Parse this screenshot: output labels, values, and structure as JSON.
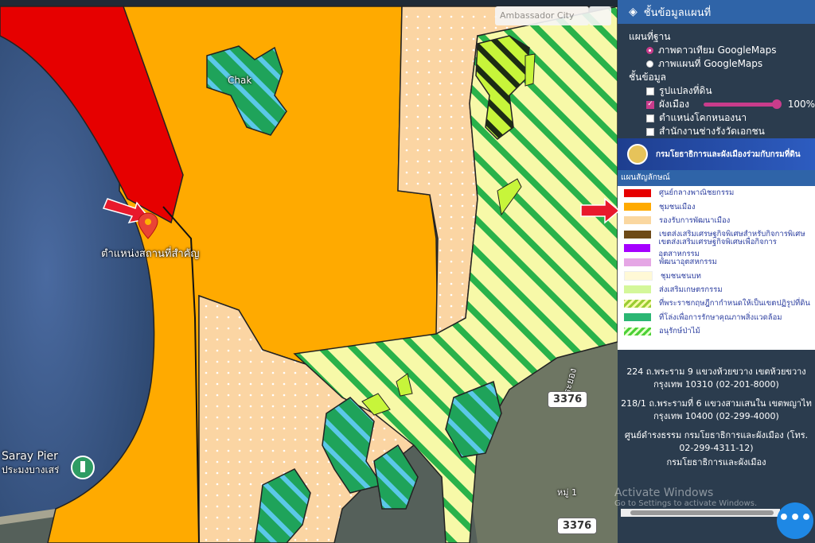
{
  "map": {
    "pin_label": "ตำแหน่งสถานที่สำคัญ",
    "search_placeholder": "Ambassador City",
    "place_labels": [
      "Saray Pier",
      "ประมงบางเสร่",
      "Chak",
      "ระยอง"
    ],
    "road_shields": [
      "3376",
      "3376"
    ],
    "village": "หมู่ 1"
  },
  "panel": {
    "title": "ชั้นข้อมูลแผนที่",
    "basemap": {
      "label": "แผนที่ฐาน",
      "options": [
        {
          "label": "ภาพดาวเทียม GoogleMaps",
          "selected": true
        },
        {
          "label": "ภาพแผนที่ GoogleMaps",
          "selected": false
        }
      ]
    },
    "data": {
      "label": "ชั้นข้อมูล",
      "layers": [
        {
          "label": "รูปแปลงที่ดิน",
          "checked": false
        },
        {
          "label": "ผังเมือง",
          "checked": true,
          "opacity": "100%"
        },
        {
          "label": "ตำแหน่งโคกหนองนา",
          "checked": false
        },
        {
          "label": "สำนักงานช่างรังวัดเอกชน",
          "checked": false
        }
      ]
    },
    "banner": "กรมโยธาธิการและผังเมืองร่วมกับกรมที่ดิน",
    "legend": {
      "title": "แผนสัญลักษณ์",
      "items": [
        {
          "label": "ศูนย์กลางพาณิชยกรรม",
          "color": "#e60000",
          "style": "solid"
        },
        {
          "label": "ชุมชนเมือง",
          "color": "#ffaa00",
          "style": "solid"
        },
        {
          "label": "รองรับการพัฒนาเมือง",
          "color": "#fad7a0",
          "style": "solid"
        },
        {
          "label": "เขตส่งเสริมเศรษฐกิจพิเศษสำหรับกิจการพิเศษ",
          "color": "#6e4a17",
          "style": "solid"
        },
        {
          "label": "เขตส่งเสริมเศรษฐกิจพิเศษเพื่อกิจการอุตสาหกรรม",
          "color": "#a500ff",
          "style": "solid"
        },
        {
          "label": "พัฒนาอุตสหกรรม",
          "color": "#e5a6e5",
          "style": "solid"
        },
        {
          "label": "ชุมชนชนบท",
          "color": "#fff9d6",
          "style": "solid"
        },
        {
          "label": "ส่งเสริมเกษตรกรรม",
          "color": "#d4f79a",
          "style": "solid"
        },
        {
          "label": "ที่พระราชกฤษฎีกากำหนดให้เป็นเขตปฏิรูปที่ดิน",
          "color": "#9acd32",
          "style": "hatch-yellow"
        },
        {
          "label": "ที่โล่งเพื่อการรักษาคุณภาพสิ่งแวดล้อม",
          "color": "#2bb673",
          "style": "solid-green"
        },
        {
          "label": "อนุรักษ์ป่าไม้",
          "color": "#4cd137",
          "style": "hatch-green"
        }
      ]
    },
    "footer": [
      "224 ถ.พระราม 9 แขวงห้วยขวาง เขตห้วยขวาง กรุงเทพ 10310 (02-201-8000)",
      "218/1 ถ.พระรามที่ 6 แขวงสามเสนใน เขตพญาไท กรุงเทพ 10400 (02-299-4000)",
      "ศูนย์ดำรงธรรม กรมโยธาธิการและผังเมือง (โทร. 02-299-4311-12)",
      "กรมโยธาธิการและผังเมือง"
    ],
    "watermark_title": "Activate Windows",
    "watermark_sub": "Go to Settings to activate Windows.",
    "fab_label": "•••"
  }
}
